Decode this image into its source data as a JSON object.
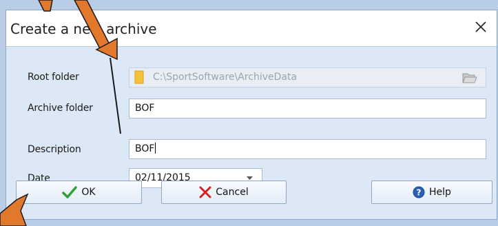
{
  "dialog": {
    "title": "Create a new archive",
    "close_symbol": "✕"
  },
  "form": {
    "root_folder": {
      "label": "Root folder",
      "value": "C:\\SportSoftware\\ArchiveData",
      "icon": "folder-icon",
      "browse_icon": "open-folder-icon"
    },
    "archive_folder": {
      "label": "Archive folder",
      "value": "BOF"
    },
    "description": {
      "label": "Description",
      "value": "BOF"
    },
    "date": {
      "label": "Date",
      "value": "02/11/2015",
      "icon": "dropdown-arrow-icon"
    }
  },
  "buttons": {
    "ok": {
      "label": "OK",
      "icon": "checkmark-icon"
    },
    "cancel": {
      "label": "Cancel",
      "icon": "x-icon"
    },
    "help": {
      "label": "Help",
      "icon": "question-icon"
    }
  },
  "colors": {
    "panel_bg": "#dde8f6",
    "annotation_arrow": "#e2782c",
    "ok_check": "#2ea13a",
    "cancel_x": "#d11f1f",
    "help_blue": "#2b5fb3"
  }
}
